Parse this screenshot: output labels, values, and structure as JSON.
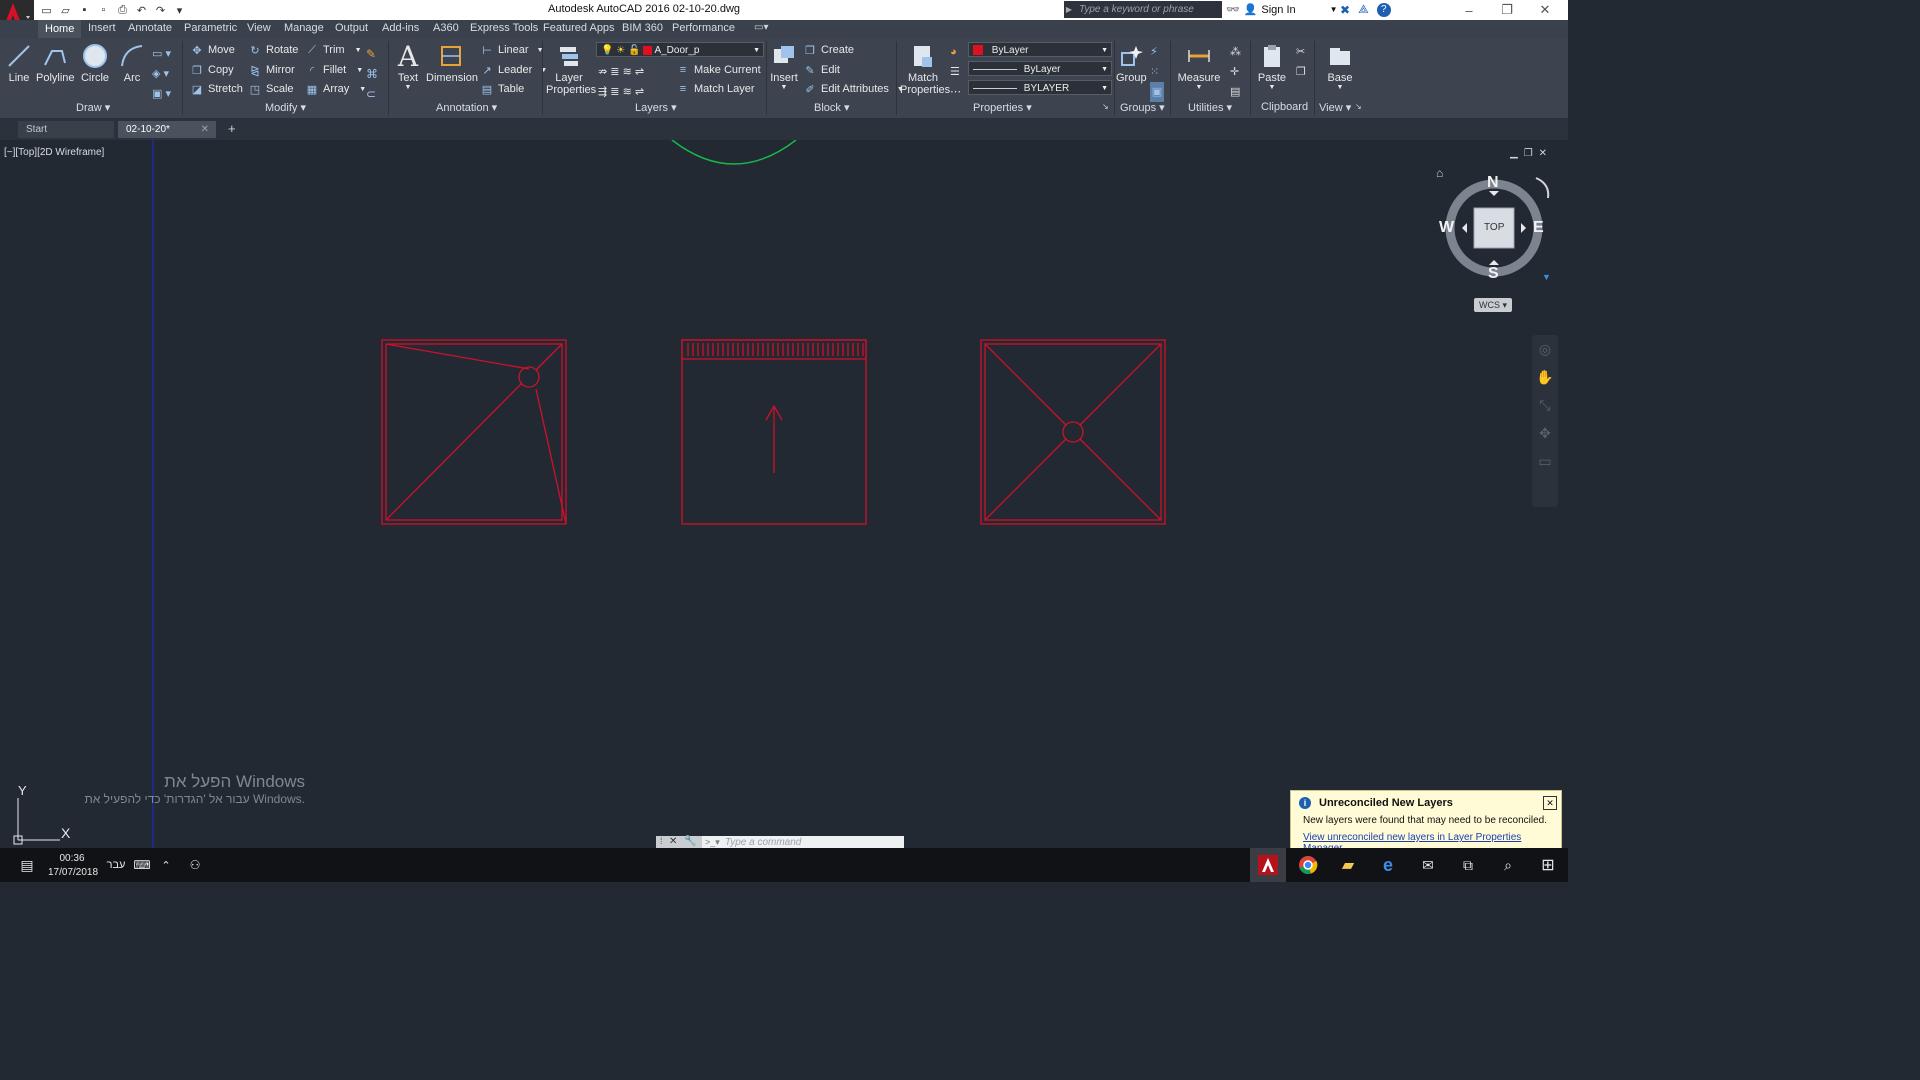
{
  "window": {
    "title": "Autodesk AutoCAD 2016    02-10-20.dwg",
    "search_placeholder": "Type a keyword or phrase",
    "signin": "Sign In"
  },
  "ribbon_tabs": [
    "Home",
    "Insert",
    "Annotate",
    "Parametric",
    "View",
    "Manage",
    "Output",
    "Add-ins",
    "A360",
    "Express Tools",
    "Featured Apps",
    "BIM 360",
    "Performance"
  ],
  "draw": {
    "title": "Draw",
    "line": "Line",
    "polyline": "Polyline",
    "circle": "Circle",
    "arc": "Arc"
  },
  "modify": {
    "title": "Modify",
    "move": "Move",
    "rotate": "Rotate",
    "trim": "Trim",
    "copy": "Copy",
    "mirror": "Mirror",
    "fillet": "Fillet",
    "stretch": "Stretch",
    "scale": "Scale",
    "array": "Array"
  },
  "annotation": {
    "title": "Annotation",
    "text": "Text",
    "dimension": "Dimension",
    "linear": "Linear",
    "leader": "Leader",
    "table": "Table"
  },
  "layers": {
    "title": "Layers",
    "layer_properties_1": "Layer",
    "layer_properties_2": "Properties",
    "current_layer": "A_Door_p",
    "make_current": "Make Current",
    "match_layer": "Match Layer"
  },
  "block": {
    "title": "Block",
    "insert": "Insert",
    "create": "Create",
    "edit": "Edit",
    "edit_attributes": "Edit Attributes"
  },
  "properties": {
    "title": "Properties",
    "match_1": "Match",
    "match_2": "Properties",
    "color": "ByLayer",
    "linetype": "ByLayer",
    "lineweight": "BYLAYER"
  },
  "groups": {
    "title": "Groups",
    "group": "Group"
  },
  "utilities": {
    "title": "Utilities",
    "measure": "Measure"
  },
  "clipboard": {
    "title": "Clipboard",
    "paste": "Paste"
  },
  "view_panel": {
    "title": "View",
    "base": "Base"
  },
  "file_tabs": {
    "start": "Start",
    "current": "02-10-20*"
  },
  "viewport": {
    "label": "[−][Top][2D Wireframe]"
  },
  "viewcube": {
    "n": "N",
    "s": "S",
    "e": "E",
    "w": "W",
    "face": "TOP",
    "wcs": "WCS"
  },
  "ucs": {
    "x": "X",
    "y": "Y"
  },
  "activation": {
    "line1": "הפעל את Windows",
    "line2": "עבור אל 'הגדרות' כדי להפעיל את Windows."
  },
  "command": {
    "placeholder": "Type a command"
  },
  "notification": {
    "title": "Unreconciled New Layers",
    "body": "New layers were found that may need to be reconciled.",
    "link": "View unreconciled new layers in Layer Properties Manager"
  },
  "taskbar": {
    "time": "00:36",
    "date": "17/07/2018",
    "lang": "עבר"
  },
  "colors": {
    "drawing_red": "#d0102a",
    "accent_blue": "#1d5fb0",
    "viewport_bg": "#222933",
    "arc_green": "#18b84a"
  }
}
